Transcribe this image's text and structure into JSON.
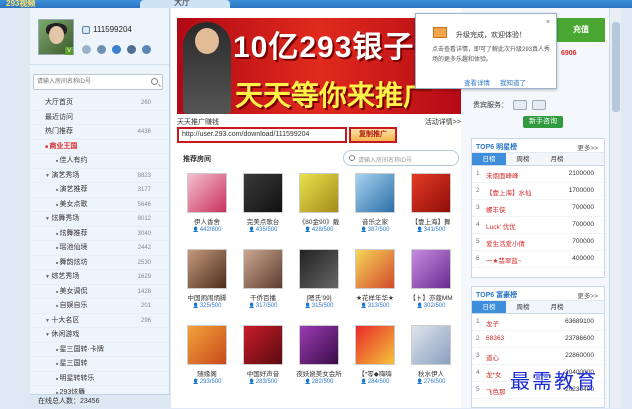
{
  "app": {
    "brand": "293视频",
    "active_tab": "大厅"
  },
  "profile": {
    "user_id": "111599204",
    "badge": "V"
  },
  "sidebar": {
    "search_placeholder": "请输入房间名称ID号",
    "items": [
      {
        "label": "大厅首页",
        "count": "260",
        "kind": "top"
      },
      {
        "label": "最近访问",
        "count": "",
        "kind": "top"
      },
      {
        "label": "热门推荐",
        "count": "4436",
        "kind": "top"
      },
      {
        "label": "商业王国",
        "count": "",
        "kind": "active"
      },
      {
        "label": "佳人有约",
        "count": "",
        "kind": "sub"
      },
      {
        "label": "演艺秀场",
        "count": "8823",
        "kind": "grp"
      },
      {
        "label": "演艺推荐",
        "count": "3177",
        "kind": "sub"
      },
      {
        "label": "美女点歌",
        "count": "5646",
        "kind": "sub"
      },
      {
        "label": "炫舞秀场",
        "count": "8012",
        "kind": "grp"
      },
      {
        "label": "炫舞推荐",
        "count": "3040",
        "kind": "sub"
      },
      {
        "label": "瑶池仙境",
        "count": "2442",
        "kind": "sub"
      },
      {
        "label": "舞韵炫坊",
        "count": "2530",
        "kind": "sub"
      },
      {
        "label": "综艺秀场",
        "count": "1629",
        "kind": "grp"
      },
      {
        "label": "美女调侃",
        "count": "1428",
        "kind": "sub"
      },
      {
        "label": "自娱自乐",
        "count": "201",
        "kind": "sub"
      },
      {
        "label": "十大名区",
        "count": "296",
        "kind": "grp"
      },
      {
        "label": "休闲游戏",
        "count": "",
        "kind": "grp"
      },
      {
        "label": "星三国转·卡牌",
        "count": "",
        "kind": "sub"
      },
      {
        "label": "星三国转",
        "count": "",
        "kind": "sub"
      },
      {
        "label": "明星转转乐",
        "count": "",
        "kind": "sub"
      },
      {
        "label": "293炫舞",
        "count": "",
        "kind": "sub"
      }
    ],
    "online_label": "在线总人数：23456"
  },
  "banner": {
    "line1": "10亿293银子",
    "line2": "天天等你来推广"
  },
  "promo": {
    "left_label": "天天推广赚钱",
    "right_link": "活动详情>>",
    "url": "http://user.293.com/download/111599204",
    "copy_button": "复制推广"
  },
  "rooms": {
    "section_title": "推荐房间",
    "search_placeholder": "请输入房间名称ID号",
    "items": [
      {
        "name": "伊人香舍",
        "stats": "442/800",
        "c1": "#f3c0d0",
        "c2": "#c9315d"
      },
      {
        "name": "完美点歌台",
        "stats": "435/500",
        "c1": "#3a3a3a",
        "c2": "#111"
      },
      {
        "name": "《80金90》戴",
        "stats": "428/500",
        "c1": "#e8e24a",
        "c2": "#a58b1c"
      },
      {
        "name": "音乐之家",
        "stats": "387/500",
        "c1": "#a7d3ef",
        "c2": "#2c6fa8"
      },
      {
        "name": "【壹上海】舞",
        "stats": "341/500",
        "c1": "#e43b26",
        "c2": "#8f0d08"
      },
      {
        "name": "中国闹闹炳脚",
        "stats": "325/500",
        "c1": "#c59a7c",
        "c2": "#4c2c1c"
      },
      {
        "name": "干侨百播",
        "stats": "317/500",
        "c1": "#caa892",
        "c2": "#5e3b2e"
      },
      {
        "name": "[嗯氏'99]",
        "stats": "315/500",
        "c1": "#222",
        "c2": "#666"
      },
      {
        "name": "★花样年华★",
        "stats": "313/500",
        "c1": "#f6d55a",
        "c2": "#d24a2a"
      },
      {
        "name": "【ト】亦蔻MM",
        "stats": "302/500",
        "c1": "#c78be0",
        "c2": "#6a2c8f"
      },
      {
        "name": "随缘阁",
        "stats": "293/500",
        "c1": "#f2a23b",
        "c2": "#c84a1a"
      },
      {
        "name": "中国好声音",
        "stats": "283/500",
        "c1": "#c81c2a",
        "c2": "#5a0b10"
      },
      {
        "name": "夜妖娆美女会所",
        "stats": "282/500",
        "c1": "#9b3bb3",
        "c2": "#3a0d48"
      },
      {
        "name": "【*零◆嗨嗨",
        "stats": "284/500",
        "c1": "#e82a2a",
        "c2": "#f5c23a"
      },
      {
        "name": "秋水伊人",
        "stats": "276/500",
        "c1": "#dfe5ee",
        "c2": "#8aa0c0"
      }
    ]
  },
  "right": {
    "recharge_button": "充值",
    "red_number": "6906",
    "vip_label": "贵宾服务：",
    "newbie_button": "新手咨询"
  },
  "popup": {
    "title": "升级完成，欢迎体验！",
    "body": "点击查看详情，即可了解此次升级293真人秀场的更多乐趣和体验。",
    "link1": "查看详情",
    "link2": "我知道了",
    "close": "×"
  },
  "star_panel": {
    "title": "TOP6 明星榜",
    "more": "更多>>",
    "tabs": [
      "日榜",
      "周榜",
      "月榜"
    ],
    "rows": [
      {
        "n": "1",
        "name": "未烟面峰峰",
        "v": "2100000"
      },
      {
        "n": "2",
        "name": "【壹上海】水仙",
        "v": "1700000"
      },
      {
        "n": "3",
        "name": "螺丰侠",
        "v": "700000"
      },
      {
        "n": "4",
        "name": "Luck' 优优",
        "v": "700000"
      },
      {
        "n": "5",
        "name": "爱生活爱小倩",
        "v": "700000"
      },
      {
        "n": "6",
        "name": "一★翡翠蓝~",
        "v": "400000"
      }
    ]
  },
  "rich_panel": {
    "title": "TOP6 富豪榜",
    "more": "更多>>",
    "tabs": [
      "日榜",
      "周榜",
      "月榜"
    ],
    "rows": [
      {
        "n": "1",
        "name": "龙子",
        "v": "63689100"
      },
      {
        "n": "2",
        "name": "68363",
        "v": "23786600"
      },
      {
        "n": "3",
        "name": "道心",
        "v": "22860000"
      },
      {
        "n": "4",
        "name": "龙*女",
        "v": "20400000"
      },
      {
        "n": "5",
        "name": "飞色那",
        "v": "20230400"
      }
    ]
  },
  "watermark": "最需教育"
}
